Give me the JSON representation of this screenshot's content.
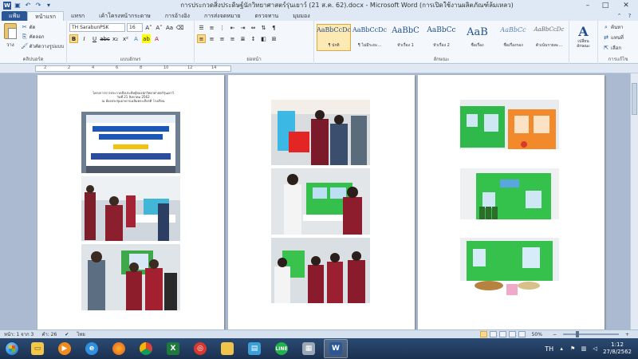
{
  "window": {
    "title": "การประกวดสิ่งประดิษฐ์นักวิทยาศาสตร์รุ่นเยาว์ (21 ส.ค. 62).docx - Microsoft Word (การเปิดใช้งานผลิตภัณฑ์ล้มเหลว)"
  },
  "tabs": [
    {
      "label": "แฟ้ม"
    },
    {
      "label": "หน้าแรก"
    },
    {
      "label": "แทรก"
    },
    {
      "label": "เค้าโครงหน้ากระดาษ"
    },
    {
      "label": "การอ้างอิง"
    },
    {
      "label": "การส่งจดหมาย"
    },
    {
      "label": "ตรวจทาน"
    },
    {
      "label": "มุมมอง"
    }
  ],
  "ribbon": {
    "clipboard": {
      "paste": "วาง",
      "cut": "ตัด",
      "copy": "คัดลอก",
      "format_painter": "ตัวคัดวางรูปแบบ",
      "group_label": "คลิปบอร์ด"
    },
    "font": {
      "name": "TH SarabunPSK",
      "size": "16",
      "group_label": "แบบอักษร"
    },
    "paragraph": {
      "group_label": "ย่อหน้า"
    },
    "styles": {
      "group_label": "ลักษณะ",
      "items": [
        {
          "sample": "AaBbCcDc",
          "name": "¶ ปกติ"
        },
        {
          "sample": "AaBbCcDc",
          "name": "¶ ไม่มีระยะ..."
        },
        {
          "sample": "AaBbC",
          "name": "หัวเรื่อง 1"
        },
        {
          "sample": "AaBbCc",
          "name": "หัวเรื่อง 2"
        },
        {
          "sample": "AaB",
          "name": "ชื่อเรื่อง"
        },
        {
          "sample": "AaBbCc",
          "name": "ชื่อเรื่องรอง"
        },
        {
          "sample": "AaBbCcDc",
          "name": "ตัวเน้นรายละ..."
        }
      ]
    },
    "change_styles": "เปลี่ยนลักษณะ",
    "editing": {
      "find": "ค้นหา",
      "replace": "แทนที่",
      "select": "เลือก",
      "group_label": "การแก้ไข"
    }
  },
  "document": {
    "page1_header": [
      "โครงการการประกวดสิ่งประดิษฐ์ของนักวิทยาศาสตร์รุ่นเยาว์",
      "วันที่ 21 สิงหาคม 2562",
      "ณ ห้องประชุมอาคารเฉลิมพระเกียรติ โรงเรียน"
    ]
  },
  "status": {
    "page": "หน้า: 1 จาก 3",
    "words": "คำ: 26",
    "language": "ไทย",
    "zoom": "50%"
  },
  "taskbar": {
    "time": "1:12",
    "date": "27/8/2562",
    "lang": "TH"
  },
  "colors": {
    "file_tab": "#2b5797",
    "ribbon_bg": "#f4f8fc",
    "doc_bg": "#abbad0",
    "taskbar": "#1b3150"
  }
}
